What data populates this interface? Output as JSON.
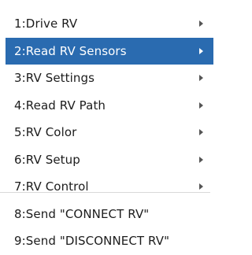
{
  "menu": {
    "items": [
      {
        "label": "1:Drive RV",
        "has_submenu": true,
        "selected": false
      },
      {
        "label": "2:Read RV Sensors",
        "has_submenu": true,
        "selected": true
      },
      {
        "label": "3:RV Settings",
        "has_submenu": true,
        "selected": false
      },
      {
        "label": "4:Read RV Path",
        "has_submenu": true,
        "selected": false
      },
      {
        "label": "5:RV Color",
        "has_submenu": true,
        "selected": false
      },
      {
        "label": "6:RV Setup",
        "has_submenu": true,
        "selected": false
      },
      {
        "label": "7:RV Control",
        "has_submenu": true,
        "selected": false
      },
      {
        "label": "8:Send \"CONNECT RV\"",
        "has_submenu": false,
        "selected": false
      },
      {
        "label": "9:Send \"DISCONNECT RV\"",
        "has_submenu": false,
        "selected": false
      }
    ],
    "colors": {
      "selected_background": "#2a6bb0",
      "selected_text": "#ffffff",
      "text": "#1c1c1c",
      "arrow": "#555555",
      "background": "#ffffff"
    }
  }
}
